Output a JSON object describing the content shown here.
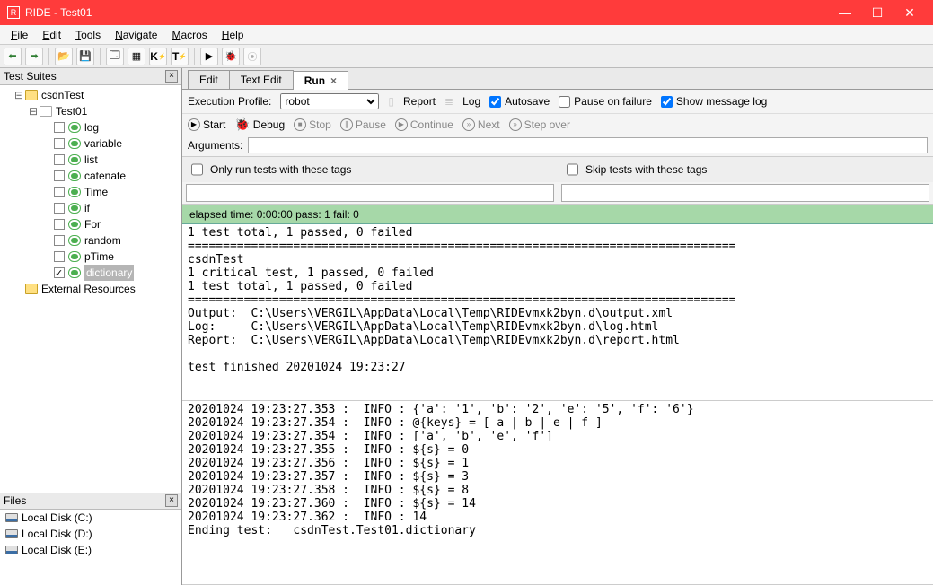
{
  "window": {
    "title": "RIDE - Test01"
  },
  "menu": {
    "file": "File",
    "edit": "Edit",
    "tools": "Tools",
    "navigate": "Navigate",
    "macros": "Macros",
    "help": "Help"
  },
  "tree_header": "Test Suites",
  "tree": {
    "root": "csdnTest",
    "suite": "Test01",
    "tests": [
      "log",
      "variable",
      "list",
      "catenate",
      "Time",
      "if",
      "For",
      "random",
      "pTime",
      "dictionary"
    ],
    "external": "External Resources"
  },
  "files_header": "Files",
  "disks": [
    "Local Disk (C:)",
    "Local Disk (D:)",
    "Local Disk (E:)"
  ],
  "tabs": {
    "edit": "Edit",
    "textedit": "Text Edit",
    "run": "Run"
  },
  "runopts": {
    "profile_label": "Execution Profile:",
    "profile_value": "robot",
    "report": "Report",
    "log": "Log",
    "autosave": "Autosave",
    "pause": "Pause on failure",
    "showlog": "Show message log"
  },
  "runctrl": {
    "start": "Start",
    "debug": "Debug",
    "stop": "Stop",
    "pause": "Pause",
    "continue": "Continue",
    "next": "Next",
    "stepover": "Step over"
  },
  "args_label": "Arguments:",
  "tags": {
    "only": "Only run tests with these tags",
    "skip": "Skip tests with these tags"
  },
  "status": "elapsed time: 0:00:00     pass: 1     fail: 0",
  "console1": "1 test total, 1 passed, 0 failed\n==============================================================================\ncsdnTest\n1 critical test, 1 passed, 0 failed\n1 test total, 1 passed, 0 failed\n==============================================================================\nOutput:  C:\\Users\\VERGIL\\AppData\\Local\\Temp\\RIDEvmxk2byn.d\\output.xml\nLog:     C:\\Users\\VERGIL\\AppData\\Local\\Temp\\RIDEvmxk2byn.d\\log.html\nReport:  C:\\Users\\VERGIL\\AppData\\Local\\Temp\\RIDEvmxk2byn.d\\report.html\n\ntest finished 20201024 19:23:27",
  "console2": "20201024 19:23:27.353 :  INFO : {'a': '1', 'b': '2', 'e': '5', 'f': '6'}\n20201024 19:23:27.354 :  INFO : @{keys} = [ a | b | e | f ]\n20201024 19:23:27.354 :  INFO : ['a', 'b', 'e', 'f']\n20201024 19:23:27.355 :  INFO : ${s} = 0\n20201024 19:23:27.356 :  INFO : ${s} = 1\n20201024 19:23:27.357 :  INFO : ${s} = 3\n20201024 19:23:27.358 :  INFO : ${s} = 8\n20201024 19:23:27.360 :  INFO : ${s} = 14\n20201024 19:23:27.362 :  INFO : 14\nEnding test:   csdnTest.Test01.dictionary"
}
